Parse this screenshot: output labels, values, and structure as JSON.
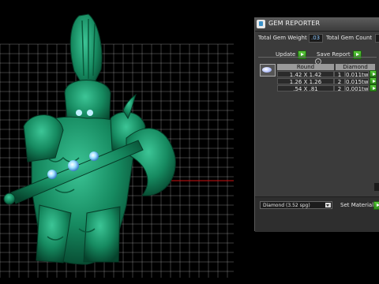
{
  "panel": {
    "title": "GEM REPORTER",
    "total_gem_weight_label": "Total Gem Weight",
    "total_gem_weight_value": ".03",
    "total_gem_count_label": "Total Gem Count",
    "update_label": "Update",
    "save_report_label": "Save Report",
    "table": {
      "headers": [
        "Round",
        "Diamond"
      ],
      "rows": [
        {
          "size": "1.42 X 1.42",
          "count": "1",
          "weight": "0.011tw"
        },
        {
          "size": "1.26 X 1.26",
          "count": "2",
          "weight": "0.015tw"
        },
        {
          "size": ".54 X .81",
          "count": "2",
          "weight": "0.001tw"
        }
      ]
    },
    "material_select_value": "Diamond     (3.52 spg)",
    "set_material_label": "Set Material"
  },
  "icons": {
    "panel": "gem-reporter-icon",
    "gem": "round-gem-icon",
    "play": "play-arrow-icon",
    "dropdown": "chevron-down-icon"
  },
  "colors": {
    "figure_green": "#1f9e73",
    "grid_line": "#bdbdbd",
    "axis_red": "#d01010",
    "accent_button_green": "#3fb02a",
    "gem_glow": "#7fd7ff"
  }
}
